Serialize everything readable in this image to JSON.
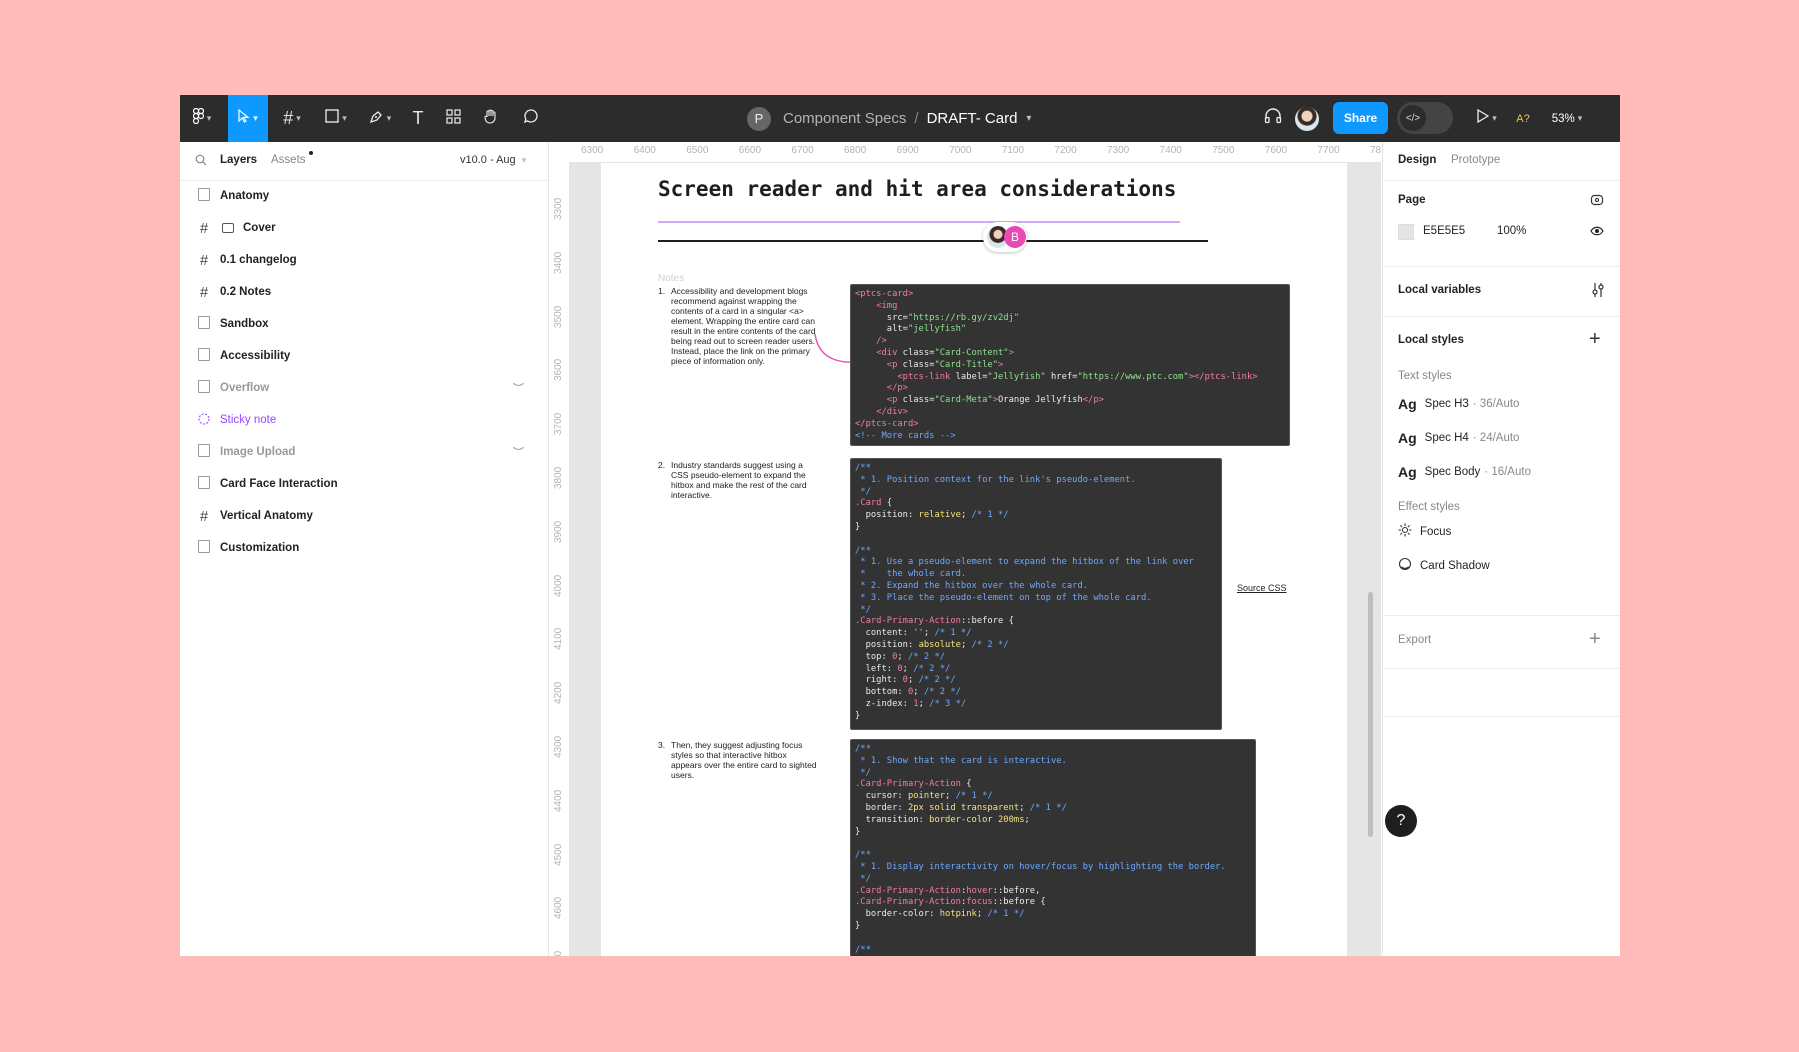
{
  "toolbar": {
    "file_initial": "P",
    "project": "Component Specs",
    "separator": "/",
    "file_name": "DRAFT- Card",
    "share_label": "Share",
    "zoom": "53%",
    "a11y_label": "A?",
    "accent": "#0D99FF"
  },
  "left_panel": {
    "tabs": {
      "layers": "Layers",
      "assets": "Assets"
    },
    "version": "v10.0 - Aug",
    "layers": [
      {
        "label": "Anatomy",
        "icon": "page-icon"
      },
      {
        "label": "Cover",
        "icon": "frame-icon"
      },
      {
        "label": "0.1 changelog",
        "icon": "frame-icon"
      },
      {
        "label": "0.2 Notes",
        "icon": "frame-icon"
      },
      {
        "label": "Sandbox",
        "icon": "page-icon"
      },
      {
        "label": "Accessibility",
        "icon": "page-icon"
      },
      {
        "label": "Overflow",
        "icon": "page-icon"
      },
      {
        "label": "Sticky note",
        "icon": "sticky-icon"
      },
      {
        "label": "Image Upload",
        "icon": "page-icon"
      },
      {
        "label": "Card Face Interaction",
        "icon": "page-icon"
      },
      {
        "label": "Vertical Anatomy",
        "icon": "frame-icon"
      },
      {
        "label": "Customization",
        "icon": "page-icon"
      }
    ]
  },
  "canvas": {
    "ruler_x": [
      "6300",
      "6400",
      "6500",
      "6600",
      "6700",
      "6800",
      "6900",
      "7000",
      "7100",
      "7200",
      "7300",
      "7400",
      "7500",
      "7600",
      "7700",
      "78"
    ],
    "ruler_y": [
      "3300",
      "3400",
      "3500",
      "3600",
      "3700",
      "3800",
      "3900",
      "4000",
      "4100",
      "4200",
      "4300",
      "4400",
      "4500",
      "4600",
      "4700"
    ],
    "doc_title": "Screen reader and hit area considerations",
    "collab_badge": "B",
    "notes_label": "Notes",
    "note_1": "Accessibility and development blogs recommend against wrapping the contents of a card in a singular <a> element. Wrapping the entire card can result in the entire contents of the card being read out to screen reader users. Instead, place the link on the primary piece of information only.",
    "note_2": "Industry standards suggest using a CSS pseudo-element to expand the hitbox and make the rest of the card interactive.",
    "note_3": "Then, they suggest adjusting focus styles so that interactive hitbox appears over the entire card to sighted users.",
    "source_link": "Source CSS"
  },
  "right_panel": {
    "tabs": {
      "design": "Design",
      "prototype": "Prototype"
    },
    "page_title": "Page",
    "page_color": "E5E5E5",
    "page_opacity": "100%",
    "local_variables": "Local variables",
    "local_styles": "Local styles",
    "text_styles_title": "Text styles",
    "text_styles": [
      {
        "name": "Spec H3",
        "meta": "· 36/Auto"
      },
      {
        "name": "Spec H4",
        "meta": "· 24/Auto"
      },
      {
        "name": "Spec Body",
        "meta": "· 16/Auto"
      }
    ],
    "effect_styles_title": "Effect styles",
    "effect_styles": [
      "Focus",
      "Card Shadow"
    ],
    "export": "Export",
    "ag": "Ag"
  },
  "help_label": "?"
}
